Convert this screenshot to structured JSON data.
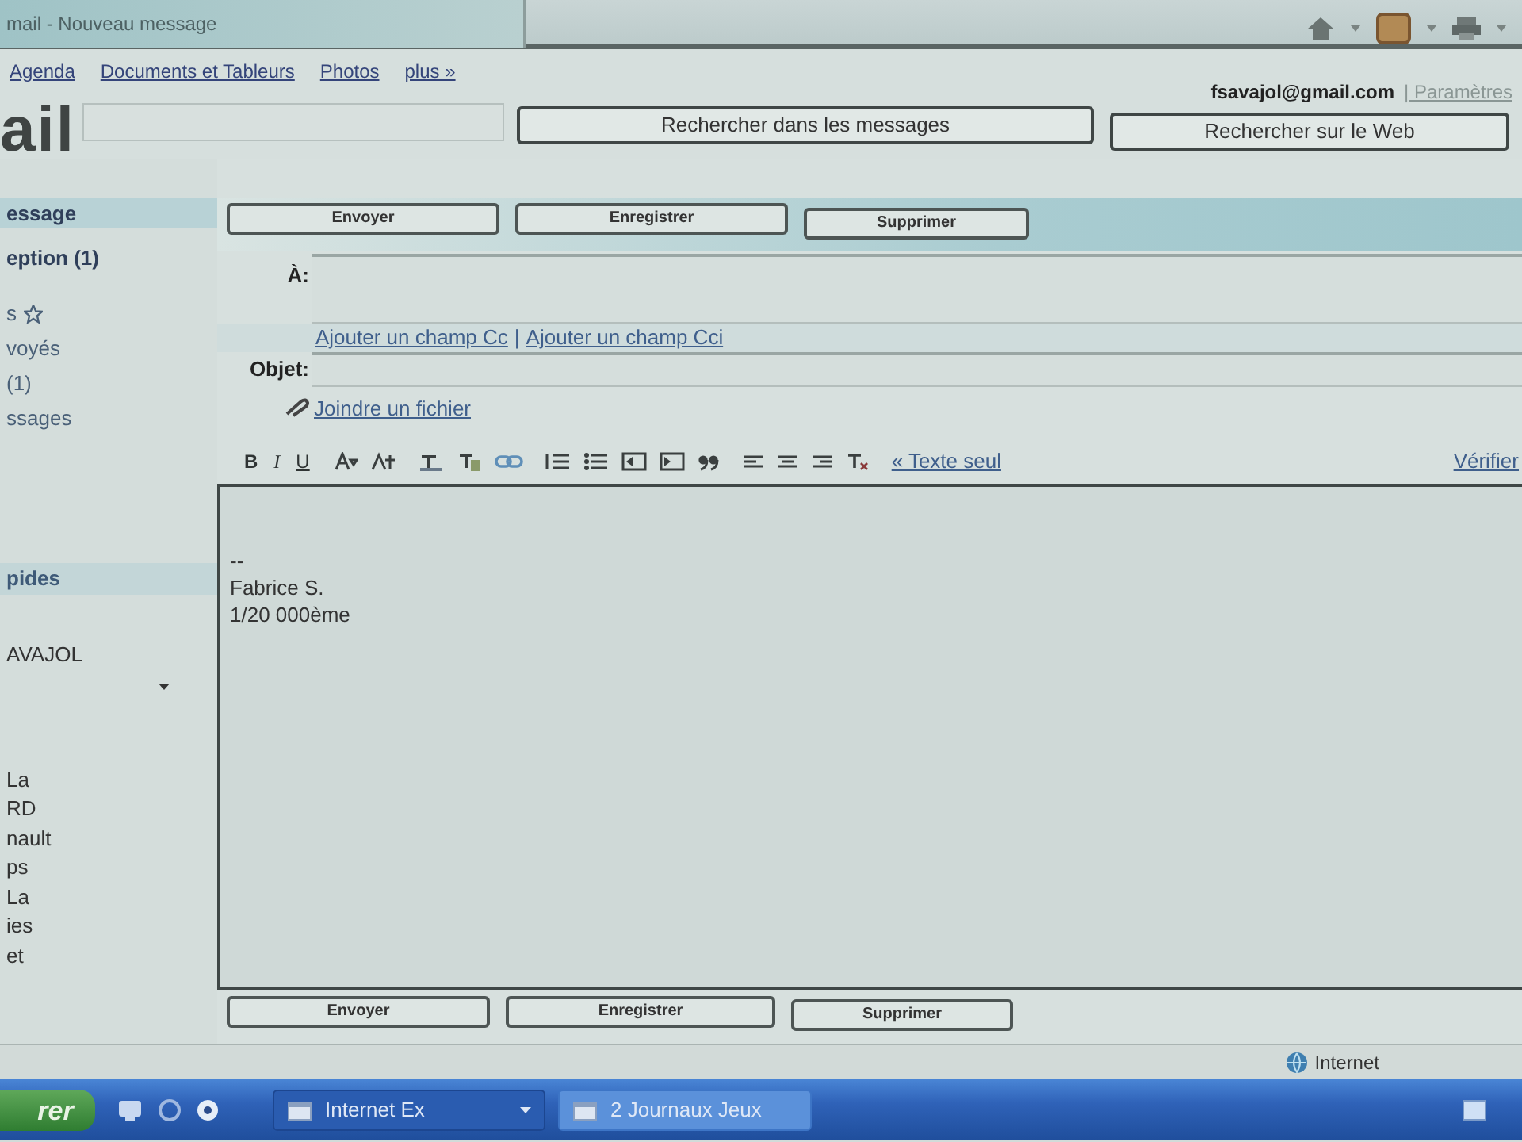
{
  "browser": {
    "tab_title": "mail - Nouveau message"
  },
  "top_nav": {
    "links": [
      "Agenda",
      "Documents et Tableurs",
      "Photos",
      "plus »"
    ],
    "account_email": "fsavajol@gmail.com",
    "settings_link": "| Paramètres"
  },
  "search": {
    "logo": "ail",
    "buttons": [
      "Rechercher dans les messages",
      "Rechercher sur le Web"
    ]
  },
  "sidebar": {
    "nav": [
      {
        "label": "essage",
        "selected": true,
        "unread": true,
        "kind": "link"
      },
      {
        "label": "eption (1)",
        "selected": false,
        "unread": true,
        "kind": "link"
      },
      {
        "label": "s",
        "selected": false,
        "unread": false,
        "kind": "starred"
      },
      {
        "label": "voyés",
        "selected": false,
        "unread": false,
        "kind": "link"
      },
      {
        "label": "(1)",
        "selected": false,
        "unread": false,
        "kind": "link"
      },
      {
        "label": "ssages",
        "selected": false,
        "unread": false,
        "kind": "link"
      }
    ],
    "contacts": {
      "title": "pides",
      "entries": [
        {
          "name": "AVAJOL"
        }
      ],
      "list": [
        "La",
        "RD",
        "nault",
        "ps",
        "La",
        "ies",
        "et"
      ]
    }
  },
  "compose": {
    "actions": [
      "Envoyer",
      "Enregistrer",
      "Supprimer"
    ],
    "to_label": "À:",
    "cc_links": [
      "Ajouter un champ Cc",
      "Ajouter un champ Cci"
    ],
    "cc_separator": "|",
    "subject_label": "Objet:",
    "attach_link": "Joindre un fichier",
    "format_buttons": [
      {
        "label": "B",
        "kind": "bold"
      },
      {
        "label": "I",
        "kind": "italic"
      },
      {
        "label": "U",
        "kind": "underline"
      }
    ],
    "plain_text_link": "« Texte seul",
    "spellcheck_link": "Vérifier",
    "body_lines": [
      "--",
      "Fabrice S.",
      "1/20 000ème"
    ],
    "bottom_actions": [
      "Envoyer",
      "Enregistrer",
      "Supprimer"
    ]
  },
  "status_bar": {
    "zone": "Internet"
  },
  "taskbar": {
    "start": "rer",
    "tasks": [
      {
        "label": "Internet Ex",
        "selected": false
      },
      {
        "label": "2 Journaux Jeux",
        "selected": true
      }
    ]
  }
}
